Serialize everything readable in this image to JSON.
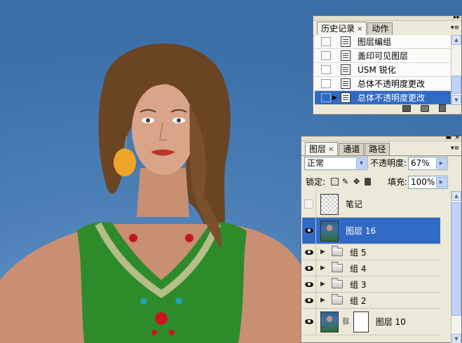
{
  "history_panel": {
    "tabs": [
      {
        "label": "历史记录",
        "active": true,
        "close_symbol": "×"
      },
      {
        "label": "动作",
        "active": false
      }
    ],
    "items": [
      {
        "label": "图层编组",
        "selected": false
      },
      {
        "label": "盖印可见图层",
        "selected": false
      },
      {
        "label": "USM 锐化",
        "selected": false
      },
      {
        "label": "总体不透明度更改",
        "selected": false
      },
      {
        "label": "总体不透明度更改",
        "selected": true
      }
    ],
    "footer_icons": [
      "new-document-from-state-icon",
      "new-snapshot-icon",
      "trash-icon"
    ]
  },
  "layers_panel": {
    "tabs": [
      {
        "label": "图层",
        "active": true,
        "close_symbol": "×"
      },
      {
        "label": "通道",
        "active": false
      },
      {
        "label": "路径",
        "active": false
      }
    ],
    "blend_mode": "正常",
    "opacity_label": "不透明度:",
    "opacity_value": "67%",
    "lock_label": "锁定:",
    "lock_icons": [
      "lock-transparent-icon",
      "lock-image-icon",
      "lock-position-icon",
      "lock-all-icon"
    ],
    "fill_label": "填充:",
    "fill_value": "100%",
    "layers": [
      {
        "name": "笔记",
        "visible": false,
        "kind": "empty-layer",
        "selected": false
      },
      {
        "name": "图层 16",
        "visible": true,
        "kind": "photo-layer",
        "selected": true
      },
      {
        "name": "组 5",
        "visible": true,
        "kind": "group",
        "selected": false
      },
      {
        "name": "组 4",
        "visible": true,
        "kind": "group",
        "selected": false
      },
      {
        "name": "组 3",
        "visible": true,
        "kind": "group",
        "selected": false
      },
      {
        "name": "组 2",
        "visible": true,
        "kind": "group",
        "selected": false
      },
      {
        "name": "图层 10",
        "visible": true,
        "kind": "masked-layer",
        "selected": false
      }
    ]
  },
  "colors": {
    "selection": "#316ac5",
    "panel_bg": "#ece9d8",
    "canvas_bg": "#4d82b8",
    "dress": "#2e8b2a"
  }
}
